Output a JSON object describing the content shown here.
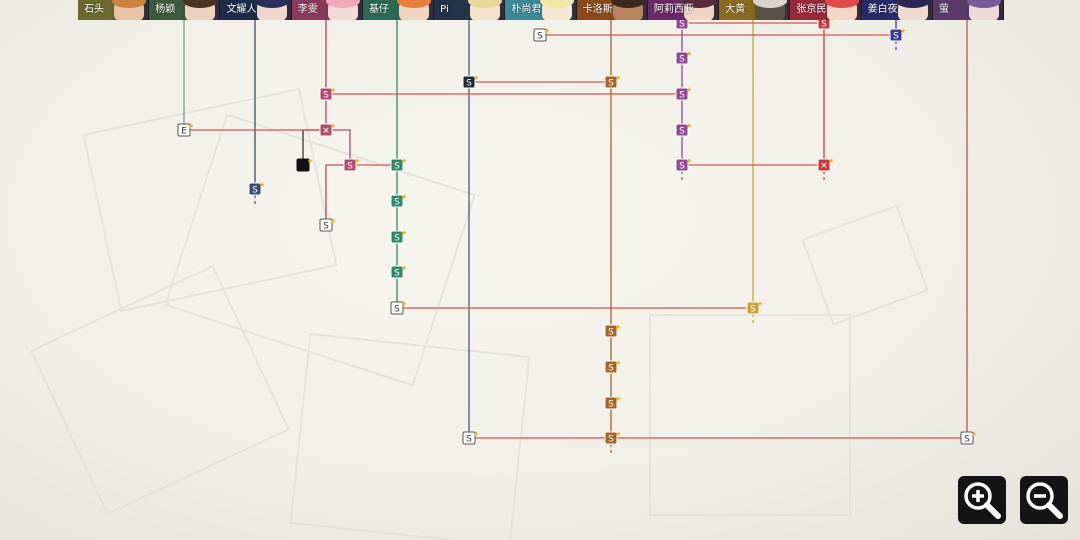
{
  "colors": {
    "link_line": "#d9534f",
    "node_plain": "#ffffff",
    "node_star": "#e0b526"
  },
  "characters": [
    {
      "name": "石头",
      "tab_color": "#6b6a2c",
      "hair": "#c9843f",
      "skin": "#e9c3a4",
      "line": null
    },
    {
      "name": "杨颖",
      "tab_color": "#3c5a3c",
      "hair": "#4b3323",
      "skin": "#edd3bd",
      "line": "#7a9f82"
    },
    {
      "name": "文耀人",
      "tab_color": "#1c2c4a",
      "hair": "#2a2e5a",
      "skin": "#eed8cc",
      "line": "#3c4a7a"
    },
    {
      "name": "李雯",
      "tab_color": "#8a3a5c",
      "hair": "#f0a9b8",
      "skin": "#f4dcd6",
      "line": "#b04a6e"
    },
    {
      "name": "基仔",
      "tab_color": "#2a6a52",
      "hair": "#e5813a",
      "skin": "#f1d5c0",
      "line": "#2e8a66"
    },
    {
      "name": "Pi",
      "tab_color": "#24324a",
      "hair": "#e6d79a",
      "skin": "#f3e2cc",
      "line": "#4a5c72"
    },
    {
      "name": "朴尚君",
      "tab_color": "#3a8a9a",
      "hair": "#f2e6a8",
      "skin": "#f5e8d2",
      "line": null
    },
    {
      "name": "卡洛斯",
      "tab_color": "#8a4a1c",
      "hair": "#3a2a20",
      "skin": "#b88360",
      "line": "#a8632a"
    },
    {
      "name": "阿莉西亚",
      "tab_color": "#6a2a6a",
      "hair": "#5a2a3a",
      "skin": "#f0d4c4",
      "line": "#8e4a92"
    },
    {
      "name": "大黄",
      "tab_color": "#8a6a1c",
      "hair": "#d8d4cc",
      "skin": "#5a5046",
      "line": "#c9a23a"
    },
    {
      "name": "张京民",
      "tab_color": "#9a2a3a",
      "hair": "#e04a4a",
      "skin": "#f3d6c4",
      "line": "#c8373a"
    },
    {
      "name": "姜白夜",
      "tab_color": "#2a2a6a",
      "hair": "#2e2652",
      "skin": "#eedad0",
      "line": "#3c3c8e"
    },
    {
      "name": "萤",
      "tab_color": "#5a3a6a",
      "hair": "#7a5a9a",
      "skin": "#efd8d8",
      "line": "#c84a5a"
    }
  ],
  "nodes": [
    {
      "id": "pi-1",
      "character": "Pi",
      "label": "S",
      "style": "dark"
    },
    {
      "id": "ka-1",
      "character": "卡洛斯",
      "label": "S",
      "style": "filled"
    },
    {
      "id": "ali-1",
      "character": "阿莉西亚",
      "label": "S",
      "style": "filled"
    },
    {
      "id": "ali-2",
      "character": "阿莉西亚",
      "label": "S",
      "style": "filled"
    },
    {
      "id": "ali-3",
      "character": "阿莉西亚",
      "label": "S",
      "style": "filled"
    },
    {
      "id": "ali-4",
      "character": "阿莉西亚",
      "label": "S",
      "style": "filled"
    },
    {
      "id": "ali-5",
      "character": "阿莉西亚",
      "label": "S",
      "style": "filled"
    },
    {
      "id": "zhang-1",
      "character": "张京民",
      "label": "S",
      "style": "filled"
    },
    {
      "id": "zhang-2",
      "character": "张京民",
      "label": "✕",
      "style": "filled"
    },
    {
      "id": "jiang-1",
      "character": "姜白夜",
      "label": "S",
      "style": "filled"
    },
    {
      "id": "pu-1",
      "character": "朴尚君",
      "label": "S",
      "style": "plain"
    },
    {
      "id": "yang-1",
      "character": "杨颖",
      "label": "E",
      "style": "plain"
    },
    {
      "id": "wen-1",
      "character": "文耀人",
      "label": "S",
      "style": "filled"
    },
    {
      "id": "li-1",
      "character": "李雯",
      "label": "S",
      "style": "filled"
    },
    {
      "id": "li-2",
      "character": "李雯",
      "label": "✕",
      "style": "filled"
    },
    {
      "id": "li-3",
      "character": "李雯",
      "label": "S",
      "style": "filled"
    },
    {
      "id": "li-4",
      "character": "李雯",
      "label": "S",
      "style": "plain"
    },
    {
      "id": "black-1",
      "character": "李雯",
      "label": "",
      "style": "black"
    },
    {
      "id": "ji-1",
      "character": "基仔",
      "label": "S",
      "style": "filled"
    },
    {
      "id": "ji-2",
      "character": "基仔",
      "label": "S",
      "style": "filled"
    },
    {
      "id": "ji-3",
      "character": "基仔",
      "label": "S",
      "style": "filled"
    },
    {
      "id": "ji-4",
      "character": "基仔",
      "label": "S",
      "style": "filled"
    },
    {
      "id": "ji-5",
      "character": "基仔",
      "label": "S",
      "style": "plain"
    },
    {
      "id": "da-1",
      "character": "大黄",
      "label": "S",
      "style": "filled"
    },
    {
      "id": "ka-2",
      "character": "卡洛斯",
      "label": "S",
      "style": "filled"
    },
    {
      "id": "ka-3",
      "character": "卡洛斯",
      "label": "S",
      "style": "filled"
    },
    {
      "id": "ka-4",
      "character": "卡洛斯",
      "label": "S",
      "style": "filled"
    },
    {
      "id": "ka-5",
      "character": "卡洛斯",
      "label": "S",
      "style": "filled"
    },
    {
      "id": "pi-2",
      "character": "Pi",
      "label": "S",
      "style": "plain"
    },
    {
      "id": "ying-1",
      "character": "萤",
      "label": "S",
      "style": "plain"
    }
  ],
  "zoom_in": {
    "icon": "zoom-in-icon"
  },
  "zoom_out": {
    "icon": "zoom-out-icon"
  }
}
